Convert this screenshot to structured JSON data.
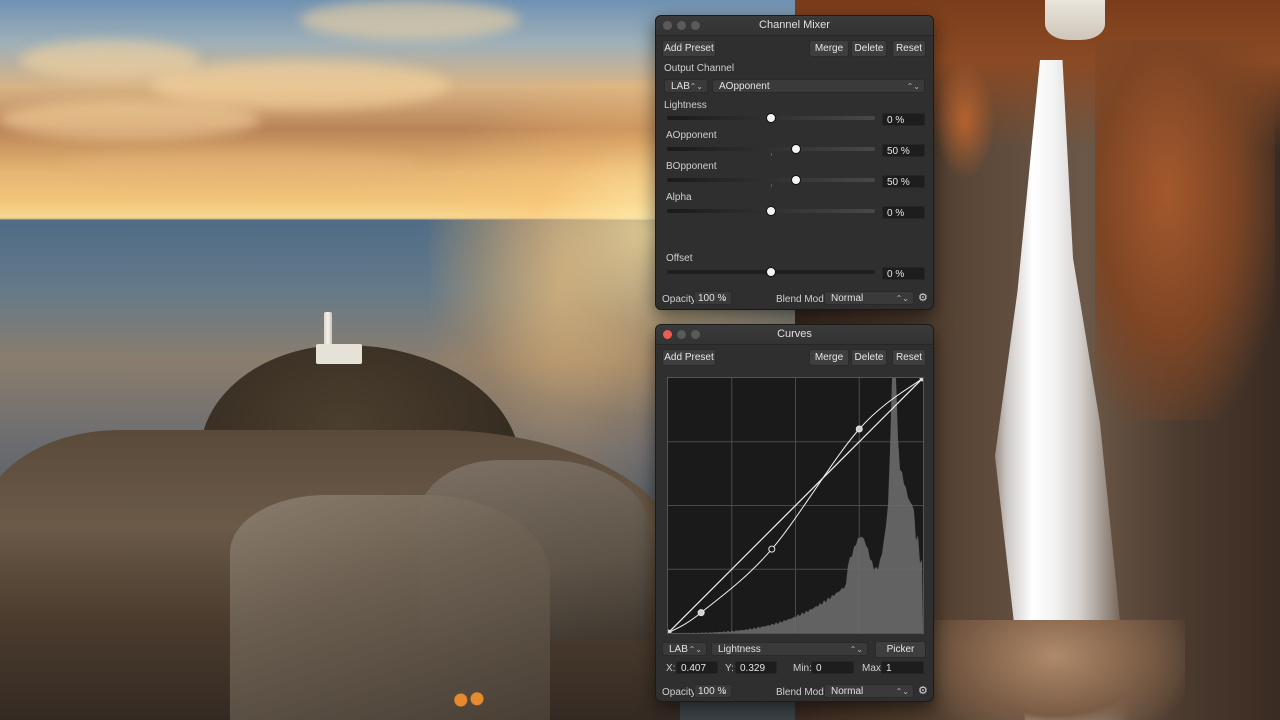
{
  "channel_mixer": {
    "title": "Channel Mixer",
    "add_preset": "Add Preset",
    "merge": "Merge",
    "delete": "Delete",
    "reset": "Reset",
    "output_channel_label": "Output Channel",
    "color_space": "LAB",
    "output_channel": "AOpponent",
    "sliders": [
      {
        "label": "Lightness",
        "value": "0 %",
        "position": 0.5
      },
      {
        "label": "AOpponent",
        "value": "50 %",
        "position": 0.62
      },
      {
        "label": "BOpponent",
        "value": "50 %",
        "position": 0.62
      },
      {
        "label": "Alpha",
        "value": "0 %",
        "position": 0.5
      }
    ],
    "offset": {
      "label": "Offset",
      "value": "0 %",
      "position": 0.5
    },
    "opacity_label": "Opacity:",
    "opacity_value": "100 %",
    "blend_mode_label": "Blend Mode:",
    "blend_mode_value": "Normal"
  },
  "curves": {
    "title": "Curves",
    "add_preset": "Add Preset",
    "merge": "Merge",
    "delete": "Delete",
    "reset": "Reset",
    "color_space": "LAB",
    "channel": "Lightness",
    "picker": "Picker",
    "x_label": "X:",
    "x_value": "0.407",
    "y_label": "Y:",
    "y_value": "0.329",
    "min_label": "Min:",
    "min_value": "0",
    "max_label": "Max:",
    "max_value": "1",
    "opacity_label": "Opacity:",
    "opacity_value": "100 %",
    "blend_mode_label": "Blend Mode:",
    "blend_mode_value": "Normal",
    "control_points": [
      [
        0,
        0
      ],
      [
        0.13,
        0.08
      ],
      [
        0.407,
        0.329
      ],
      [
        0.75,
        0.8
      ],
      [
        1,
        1
      ]
    ]
  },
  "colors": {
    "panel_bg": "#2f2f2f",
    "close_red": "#ee5b52",
    "curve_white": "#f0f0f0"
  }
}
